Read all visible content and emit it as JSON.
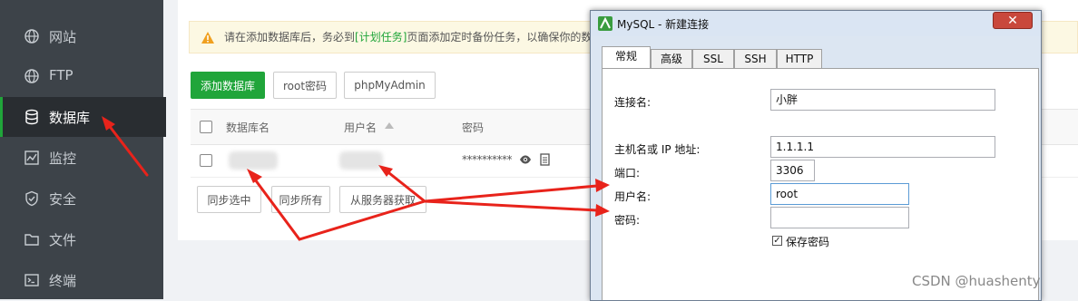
{
  "sidebar": {
    "items": [
      {
        "label": "网站",
        "icon": "globe-icon"
      },
      {
        "label": "FTP",
        "icon": "globe-icon"
      },
      {
        "label": "数据库",
        "icon": "database-icon",
        "active": true
      },
      {
        "label": "监控",
        "icon": "monitor-icon"
      },
      {
        "label": "安全",
        "icon": "shield-icon"
      },
      {
        "label": "文件",
        "icon": "folder-icon"
      },
      {
        "label": "终端",
        "icon": "terminal-icon"
      }
    ]
  },
  "notice": {
    "before": "请在添加数据库后，务必到",
    "link": "[计划任务]",
    "after": "页面添加定时备份任务，以确保你的数"
  },
  "toolbar": {
    "add_db": "添加数据库",
    "root_pwd": "root密码",
    "phpmyadmin": "phpMyAdmin"
  },
  "table": {
    "headers": {
      "db_name": "数据库名",
      "username": "用户名",
      "password": "密码"
    },
    "row": {
      "password_masked": "**********"
    }
  },
  "sync": {
    "selected": "同步选中",
    "all": "同步所有",
    "from_server": "从服务器获取"
  },
  "dialog": {
    "title": "MySQL - 新建连接",
    "close": "✕",
    "tabs": [
      "常规",
      "高级",
      "SSL",
      "SSH",
      "HTTP"
    ],
    "fields": {
      "conn_name_label": "连接名:",
      "conn_name_value": "小胖",
      "host_label": "主机名或 IP 地址:",
      "host_value": "1.1.1.1",
      "port_label": "端口:",
      "port_value": "3306",
      "user_label": "用户名:",
      "user_value": "root",
      "password_label": "密码:",
      "password_value": "",
      "save_password_label": "保存密码",
      "save_password_checked": true
    }
  },
  "watermark": "CSDN @huashenty",
  "colors": {
    "accent": "#20a53a",
    "sidebar_bg": "#3d4349",
    "annotation_red": "#e8231b"
  }
}
